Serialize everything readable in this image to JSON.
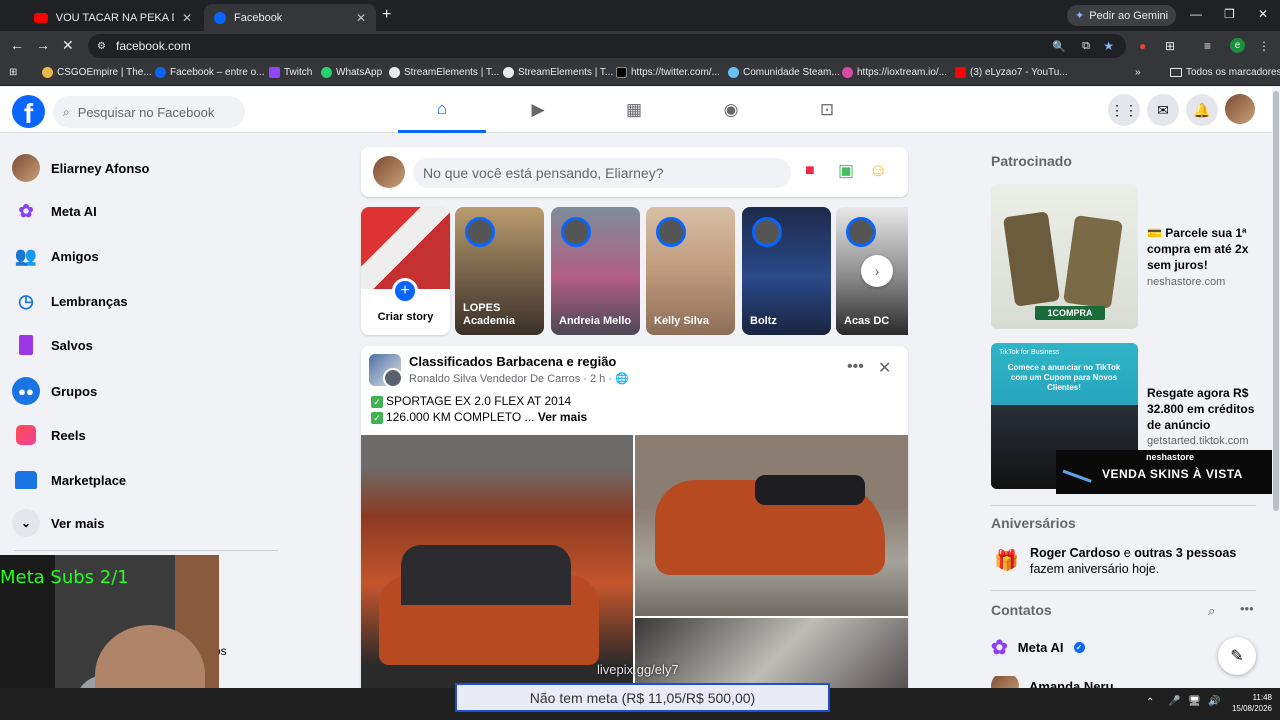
{
  "browser": {
    "tabs": [
      {
        "title": "VOU TACAR NA PEKA DAS BB -",
        "icon": "youtube-icon"
      },
      {
        "title": "Facebook",
        "icon": "facebook-icon"
      }
    ],
    "gemini_label": "Pedir ao Gemini",
    "url": "facebook.com",
    "bookmarks": [
      "CSGOEmpire | The...",
      "Facebook – entre o...",
      "Twitch",
      "WhatsApp",
      "StreamElements | T...",
      "StreamElements | T...",
      "https://twitter.com/...",
      "Comunidade Steam...",
      "https://ioxtream.io/...",
      "(3) eLyzao7 - YouTu..."
    ],
    "all_bookmarks": "Todos os marcadores",
    "profile_letter": "e"
  },
  "fb": {
    "search_placeholder": "Pesquisar no Facebook",
    "sidebar": [
      {
        "label": "Eliarney Afonso",
        "icon": "profile-avatar"
      },
      {
        "label": "Meta AI",
        "icon": "meta-ai-icon"
      },
      {
        "label": "Amigos",
        "icon": "friends-icon"
      },
      {
        "label": "Lembranças",
        "icon": "memories-icon"
      },
      {
        "label": "Salvos",
        "icon": "saved-icon"
      },
      {
        "label": "Grupos",
        "icon": "groups-icon"
      },
      {
        "label": "Reels",
        "icon": "reels-icon"
      },
      {
        "label": "Marketplace",
        "icon": "marketplace-icon"
      },
      {
        "label": "Ver mais",
        "icon": "chevron-down-icon"
      }
    ],
    "composer_placeholder": "No que você está pensando, Eliarney?",
    "stories": {
      "create_label": "Criar story",
      "items": [
        {
          "name": "LOPES Academia"
        },
        {
          "name": "Andreia Mello"
        },
        {
          "name": "Kelly Silva"
        },
        {
          "name": "Boltz"
        },
        {
          "name": "Acas DC"
        }
      ]
    },
    "post": {
      "group": "Classificados Barbacena e região",
      "author_meta": "Ronaldo Silva Vendedor De Carros · 2 h ·",
      "line1": "SPORTAGE EX 2.0 FLEX AT 2014",
      "line2": "126.000 KM COMPLETO ...",
      "see_more": "Ver mais"
    },
    "right": {
      "sponsored": "Patrocinado",
      "ads": [
        {
          "title": "💳 Parcele sua 1ª compra em até 2x sem juros!",
          "url": "neshastore.com"
        },
        {
          "title": "Resgate agora R$ 32.800 em créditos de anúncio",
          "url": "getstarted.tiktok.com"
        }
      ],
      "ad1_img_caption": "1COMPRA",
      "ad2_img_caption": "Comece a anunciar no TikTok com um Cupom para Novos Clientes!",
      "ad2_brand": "TikTok for Business",
      "birthdays_title": "Aniversários",
      "birthday_name": "Roger Cardoso",
      "birthday_mid": " e ",
      "birthday_others": "outras 3 pessoas",
      "birthday_rest": " fazem aniversário hoje.",
      "contacts_title": "Contatos",
      "contact_meta_ai": "Meta AI",
      "contact_partial": "Amanda Neru"
    }
  },
  "overlay": {
    "webcam_sub": "Meta Subs 2/1",
    "skins_brand": "neshastore",
    "skins_text": "VENDA SKINS À VISTA",
    "livepix": "livepix.gg/ely7",
    "donation": "Não tem meta (R$ 11,05/R$ 500,00)",
    "left_partial": "os"
  },
  "taskbar": {
    "time": "11:48",
    "date": "15/08/2026"
  }
}
